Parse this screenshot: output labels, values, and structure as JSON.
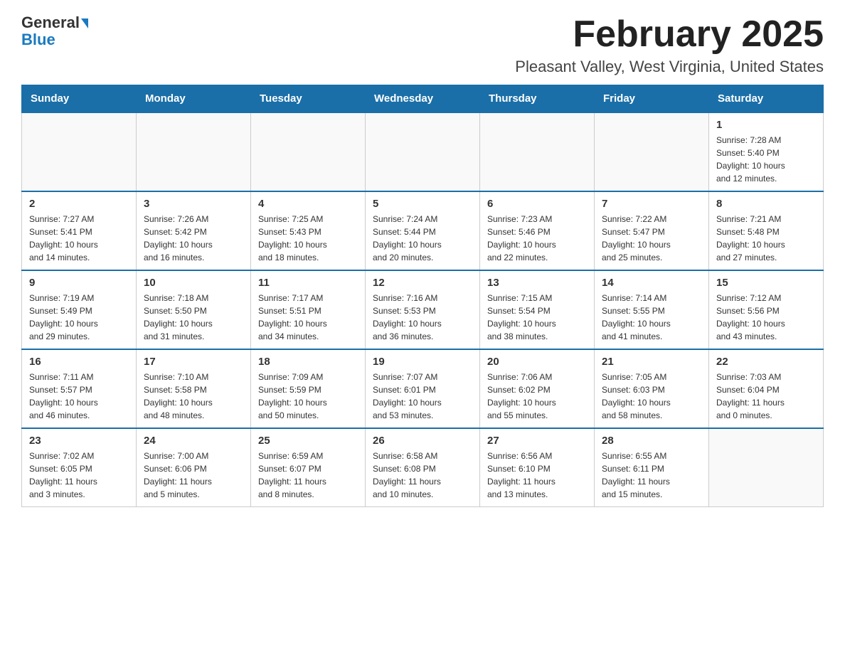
{
  "header": {
    "logo_line1": "General",
    "logo_line2": "Blue",
    "title": "February 2025",
    "subtitle": "Pleasant Valley, West Virginia, United States"
  },
  "days_of_week": [
    "Sunday",
    "Monday",
    "Tuesday",
    "Wednesday",
    "Thursday",
    "Friday",
    "Saturday"
  ],
  "weeks": [
    {
      "days": [
        {
          "number": "",
          "info": ""
        },
        {
          "number": "",
          "info": ""
        },
        {
          "number": "",
          "info": ""
        },
        {
          "number": "",
          "info": ""
        },
        {
          "number": "",
          "info": ""
        },
        {
          "number": "",
          "info": ""
        },
        {
          "number": "1",
          "info": "Sunrise: 7:28 AM\nSunset: 5:40 PM\nDaylight: 10 hours\nand 12 minutes."
        }
      ]
    },
    {
      "days": [
        {
          "number": "2",
          "info": "Sunrise: 7:27 AM\nSunset: 5:41 PM\nDaylight: 10 hours\nand 14 minutes."
        },
        {
          "number": "3",
          "info": "Sunrise: 7:26 AM\nSunset: 5:42 PM\nDaylight: 10 hours\nand 16 minutes."
        },
        {
          "number": "4",
          "info": "Sunrise: 7:25 AM\nSunset: 5:43 PM\nDaylight: 10 hours\nand 18 minutes."
        },
        {
          "number": "5",
          "info": "Sunrise: 7:24 AM\nSunset: 5:44 PM\nDaylight: 10 hours\nand 20 minutes."
        },
        {
          "number": "6",
          "info": "Sunrise: 7:23 AM\nSunset: 5:46 PM\nDaylight: 10 hours\nand 22 minutes."
        },
        {
          "number": "7",
          "info": "Sunrise: 7:22 AM\nSunset: 5:47 PM\nDaylight: 10 hours\nand 25 minutes."
        },
        {
          "number": "8",
          "info": "Sunrise: 7:21 AM\nSunset: 5:48 PM\nDaylight: 10 hours\nand 27 minutes."
        }
      ]
    },
    {
      "days": [
        {
          "number": "9",
          "info": "Sunrise: 7:19 AM\nSunset: 5:49 PM\nDaylight: 10 hours\nand 29 minutes."
        },
        {
          "number": "10",
          "info": "Sunrise: 7:18 AM\nSunset: 5:50 PM\nDaylight: 10 hours\nand 31 minutes."
        },
        {
          "number": "11",
          "info": "Sunrise: 7:17 AM\nSunset: 5:51 PM\nDaylight: 10 hours\nand 34 minutes."
        },
        {
          "number": "12",
          "info": "Sunrise: 7:16 AM\nSunset: 5:53 PM\nDaylight: 10 hours\nand 36 minutes."
        },
        {
          "number": "13",
          "info": "Sunrise: 7:15 AM\nSunset: 5:54 PM\nDaylight: 10 hours\nand 38 minutes."
        },
        {
          "number": "14",
          "info": "Sunrise: 7:14 AM\nSunset: 5:55 PM\nDaylight: 10 hours\nand 41 minutes."
        },
        {
          "number": "15",
          "info": "Sunrise: 7:12 AM\nSunset: 5:56 PM\nDaylight: 10 hours\nand 43 minutes."
        }
      ]
    },
    {
      "days": [
        {
          "number": "16",
          "info": "Sunrise: 7:11 AM\nSunset: 5:57 PM\nDaylight: 10 hours\nand 46 minutes."
        },
        {
          "number": "17",
          "info": "Sunrise: 7:10 AM\nSunset: 5:58 PM\nDaylight: 10 hours\nand 48 minutes."
        },
        {
          "number": "18",
          "info": "Sunrise: 7:09 AM\nSunset: 5:59 PM\nDaylight: 10 hours\nand 50 minutes."
        },
        {
          "number": "19",
          "info": "Sunrise: 7:07 AM\nSunset: 6:01 PM\nDaylight: 10 hours\nand 53 minutes."
        },
        {
          "number": "20",
          "info": "Sunrise: 7:06 AM\nSunset: 6:02 PM\nDaylight: 10 hours\nand 55 minutes."
        },
        {
          "number": "21",
          "info": "Sunrise: 7:05 AM\nSunset: 6:03 PM\nDaylight: 10 hours\nand 58 minutes."
        },
        {
          "number": "22",
          "info": "Sunrise: 7:03 AM\nSunset: 6:04 PM\nDaylight: 11 hours\nand 0 minutes."
        }
      ]
    },
    {
      "days": [
        {
          "number": "23",
          "info": "Sunrise: 7:02 AM\nSunset: 6:05 PM\nDaylight: 11 hours\nand 3 minutes."
        },
        {
          "number": "24",
          "info": "Sunrise: 7:00 AM\nSunset: 6:06 PM\nDaylight: 11 hours\nand 5 minutes."
        },
        {
          "number": "25",
          "info": "Sunrise: 6:59 AM\nSunset: 6:07 PM\nDaylight: 11 hours\nand 8 minutes."
        },
        {
          "number": "26",
          "info": "Sunrise: 6:58 AM\nSunset: 6:08 PM\nDaylight: 11 hours\nand 10 minutes."
        },
        {
          "number": "27",
          "info": "Sunrise: 6:56 AM\nSunset: 6:10 PM\nDaylight: 11 hours\nand 13 minutes."
        },
        {
          "number": "28",
          "info": "Sunrise: 6:55 AM\nSunset: 6:11 PM\nDaylight: 11 hours\nand 15 minutes."
        },
        {
          "number": "",
          "info": ""
        }
      ]
    }
  ]
}
